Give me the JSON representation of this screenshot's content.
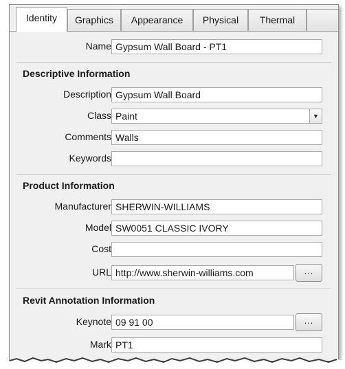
{
  "tabs": [
    {
      "label": "Identity",
      "active": true
    },
    {
      "label": "Graphics",
      "active": false
    },
    {
      "label": "Appearance",
      "active": false
    },
    {
      "label": "Physical",
      "active": false
    },
    {
      "label": "Thermal",
      "active": false
    }
  ],
  "name": {
    "label": "Name",
    "value": "Gypsum Wall Board - PT1"
  },
  "descriptive": {
    "title": "Descriptive Information",
    "description": {
      "label": "Description",
      "value": "Gypsum Wall Board"
    },
    "class": {
      "label": "Class",
      "value": "Paint"
    },
    "comments": {
      "label": "Comments",
      "value": "Walls"
    },
    "keywords": {
      "label": "Keywords",
      "value": ""
    }
  },
  "product": {
    "title": "Product Information",
    "manufacturer": {
      "label": "Manufacturer",
      "value": "SHERWIN-WILLIAMS"
    },
    "model": {
      "label": "Model",
      "value": "SW0051 CLASSIC IVORY"
    },
    "cost": {
      "label": "Cost",
      "value": ""
    },
    "url": {
      "label": "URL",
      "value": "http://www.sherwin-williams.com",
      "button": "..."
    }
  },
  "revit": {
    "title": "Revit Annotation Information",
    "keynote": {
      "label": "Keynote",
      "value": "09 91 00",
      "button": "..."
    },
    "mark": {
      "label": "Mark",
      "value": "PT1"
    }
  }
}
